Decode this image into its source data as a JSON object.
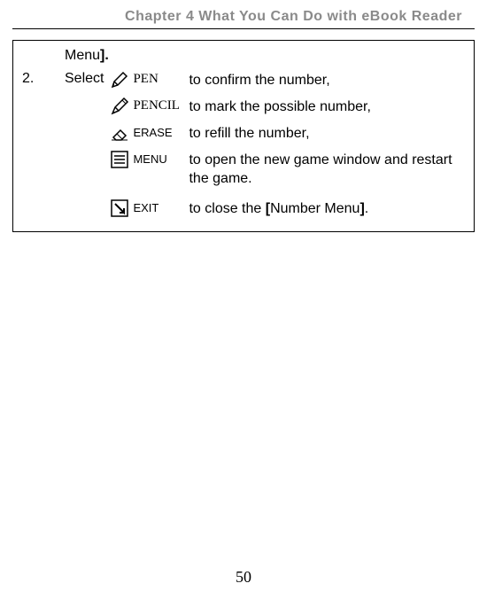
{
  "header": "Chapter 4 What You Can Do with eBook Reader",
  "line1_a": "Menu",
  "line1_b": "].",
  "step_num": "2.",
  "step_word": "Select",
  "options": [
    {
      "icon_label": "PEN",
      "desc": "to confirm the number,"
    },
    {
      "icon_label": "PENCIL",
      "desc": "to mark the possible number,"
    },
    {
      "icon_label": "ERASE",
      "desc": "to refill the number,"
    },
    {
      "icon_label": "MENU",
      "desc": "to open the new game window and restart the game."
    },
    {
      "icon_label": "EXIT",
      "desc_a": "to close the ",
      "desc_b": "[",
      "desc_c": "Number Menu",
      "desc_d": "]",
      "desc_e": "."
    }
  ],
  "pagenum": "50"
}
